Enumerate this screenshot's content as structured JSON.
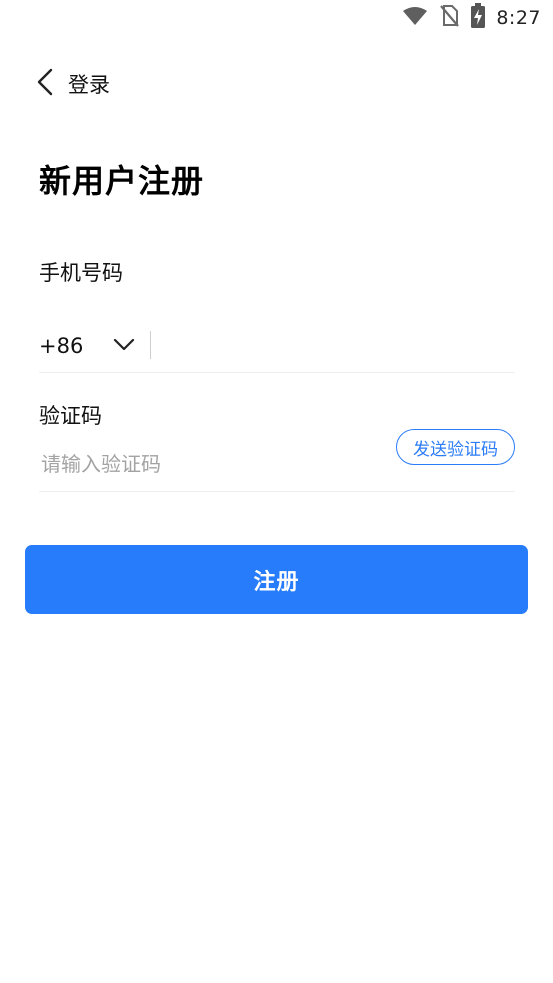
{
  "status_bar": {
    "time": "8:27",
    "icons": [
      "wifi-icon",
      "no-sim-icon",
      "battery-charging-icon"
    ]
  },
  "nav": {
    "back_label": "登录",
    "back_icon": "chevron-left-icon"
  },
  "page": {
    "title": "新用户注册"
  },
  "phone": {
    "label": "手机号码",
    "country_code": "+86",
    "country_icon": "chevron-down-icon",
    "value": "",
    "placeholder": ""
  },
  "verification": {
    "label": "验证码",
    "placeholder": "请输入验证码",
    "value": "",
    "send_button_label": "发送验证码"
  },
  "actions": {
    "register_label": "注册"
  },
  "colors": {
    "accent": "#267cfb",
    "divider": "#eeeeee",
    "placeholder": "#a3a3a3"
  }
}
